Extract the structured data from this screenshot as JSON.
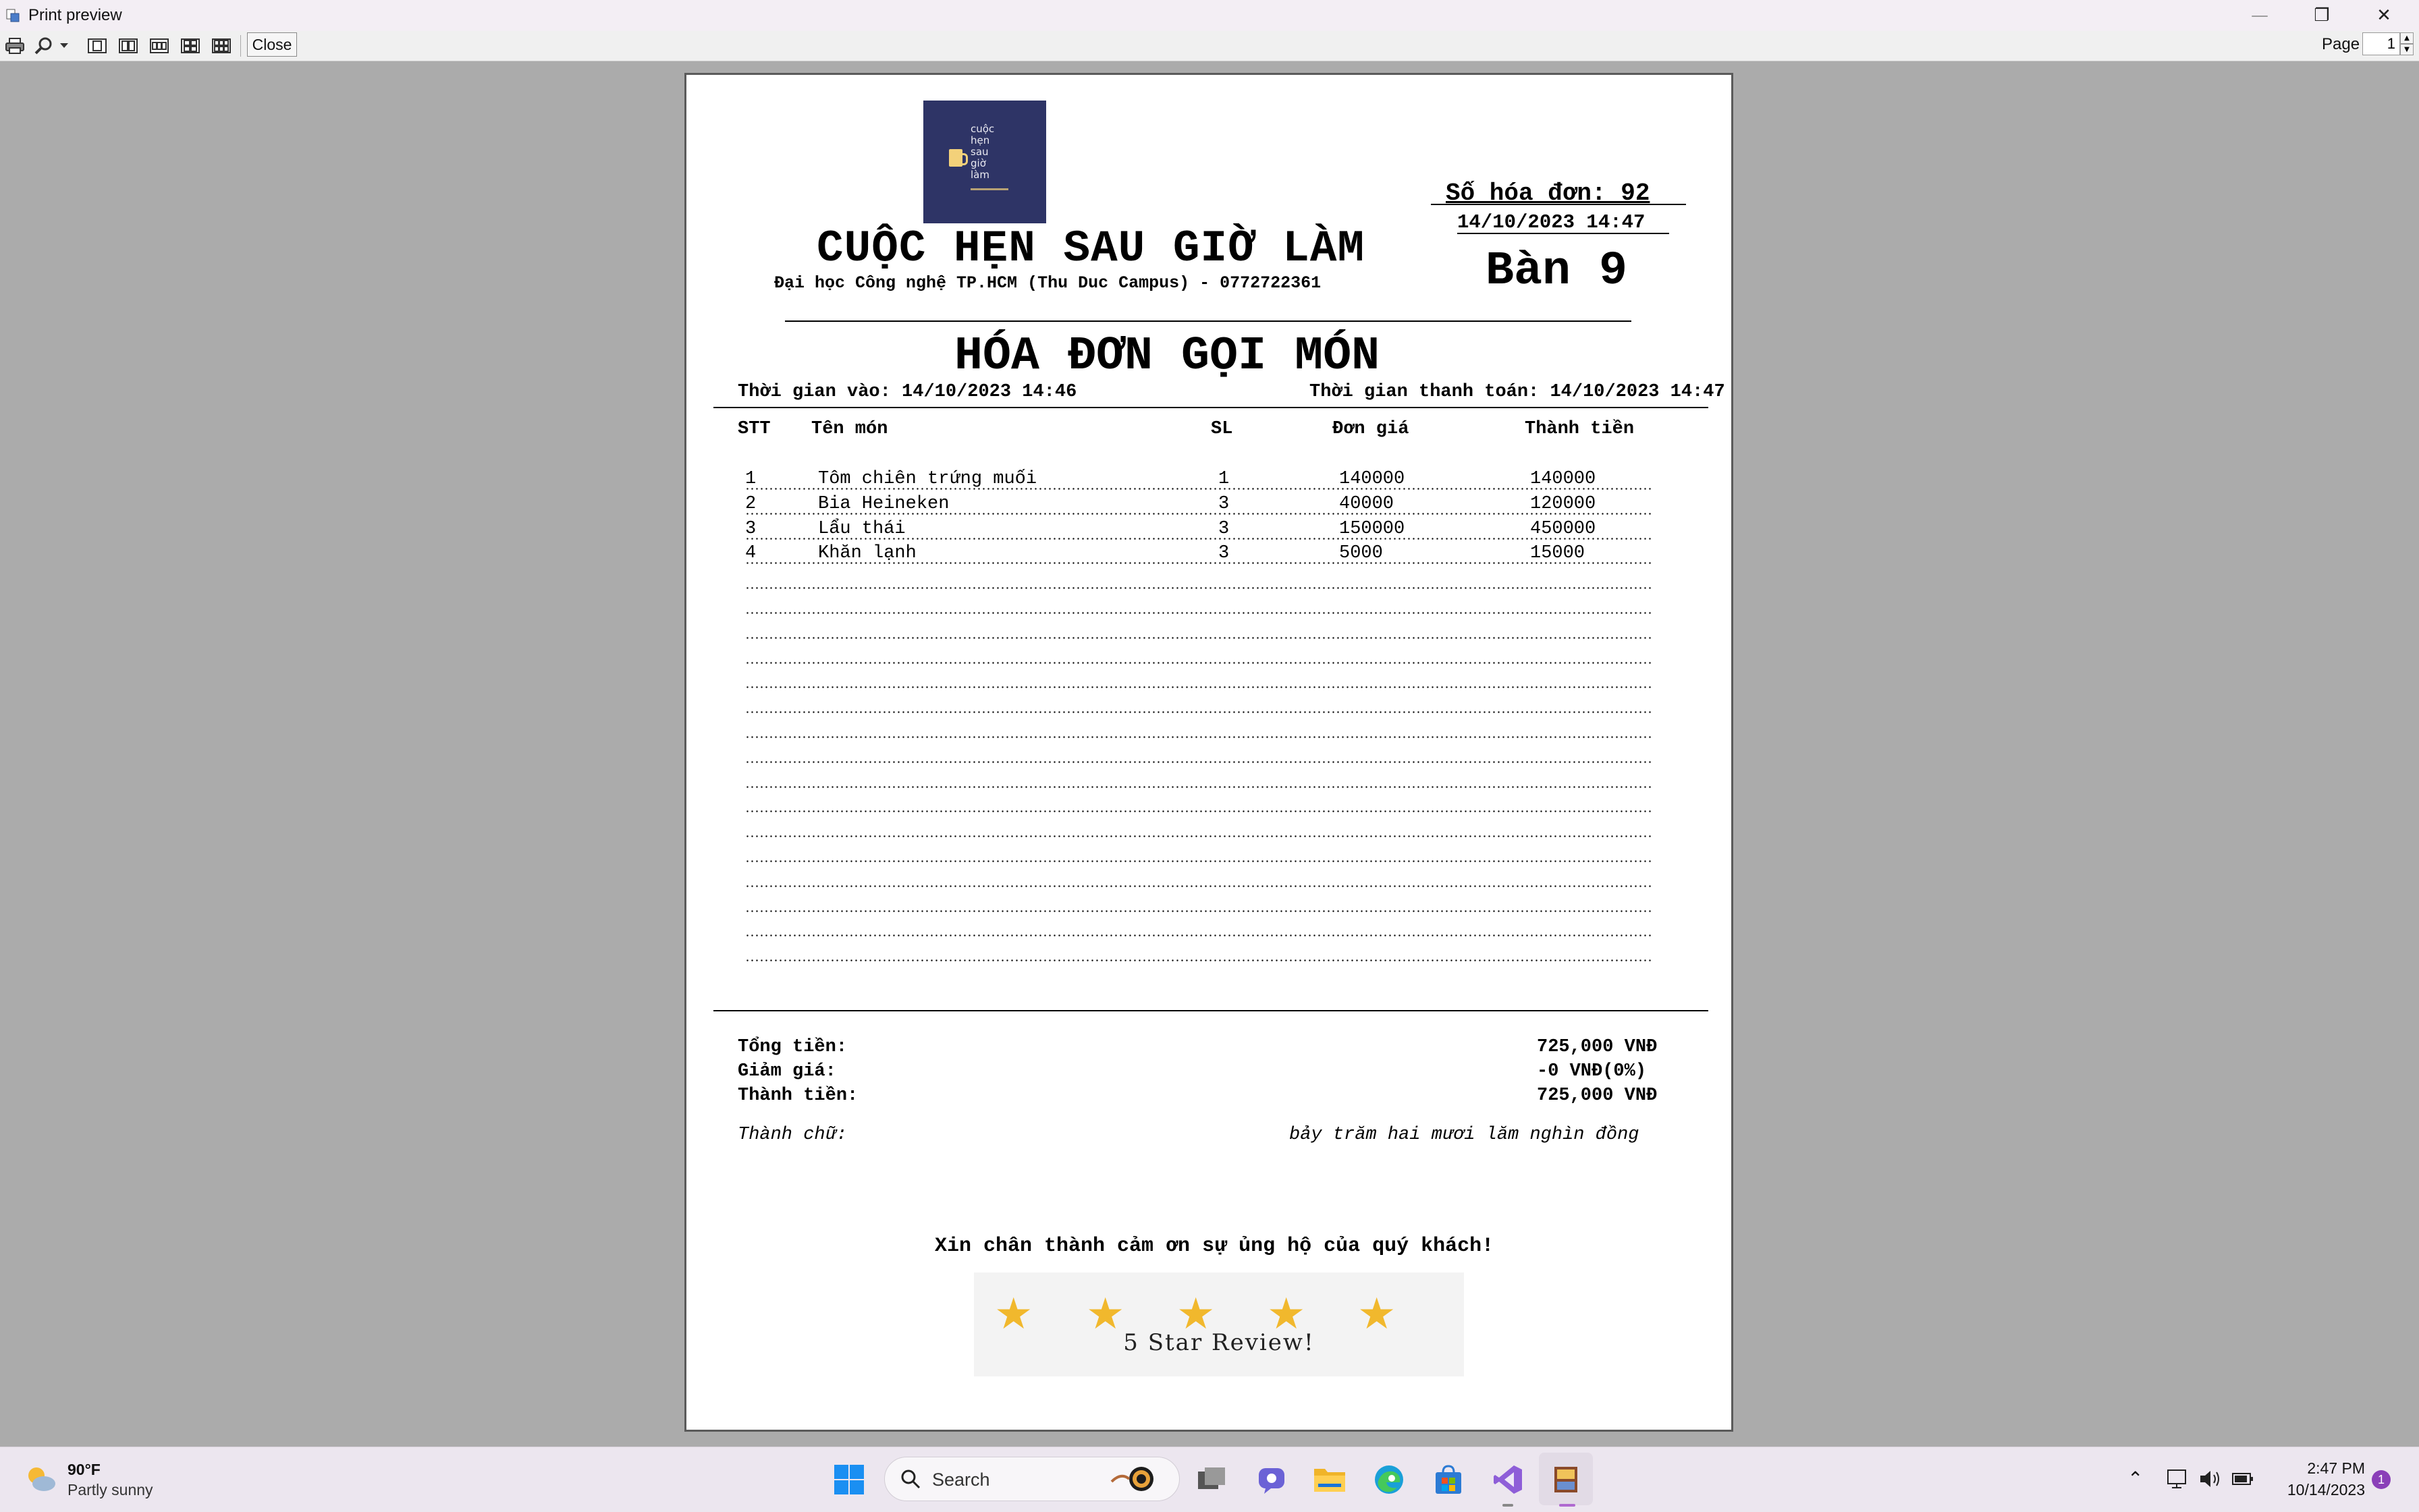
{
  "window": {
    "title": "Print preview",
    "minimize_glyph": "—",
    "restore_glyph": "❐",
    "close_glyph": "✕"
  },
  "toolbar": {
    "icons": [
      "print-icon",
      "zoom-icon",
      "dropdown-arrow-icon",
      "one-page-icon",
      "two-pages-icon",
      "three-pages-icon",
      "four-pages-icon",
      "six-pages-icon"
    ],
    "close_label": "Close",
    "page_label": "Page",
    "page_value": "1"
  },
  "receipt": {
    "logo_text": [
      "cuộc",
      "hẹn",
      "sau",
      "giờ",
      "làm"
    ],
    "invoice_number": "Số hóa đơn: 92",
    "invoice_datetime": "14/10/2023 14:47",
    "store_name": "CUỘC HẸN SAU GIỜ LÀM",
    "store_address": "Đại học Công nghệ TP.HCM (Thu Duc Campus) - 0772722361",
    "table_label": "Bàn 9",
    "doc_title": "HÓA ĐƠN GỌI MÓN",
    "time_in": "Thời gian vào: 14/10/2023 14:46",
    "time_paid": "Thời gian thanh toán: 14/10/2023 14:47",
    "columns": [
      "STT",
      "Tên món",
      "SL",
      "Đơn giá",
      "Thành tiền"
    ],
    "items": [
      {
        "stt": "1",
        "name": "Tôm chiên trứng muối",
        "qty": "1",
        "price": "140000",
        "total": "140000"
      },
      {
        "stt": "2",
        "name": "Bia Heineken",
        "qty": "3",
        "price": "40000",
        "total": "120000"
      },
      {
        "stt": "3",
        "name": "Lẩu thái",
        "qty": "3",
        "price": "150000",
        "total": "450000"
      },
      {
        "stt": "4",
        "name": "Khăn lạnh",
        "qty": "3",
        "price": "5000",
        "total": "15000"
      }
    ],
    "subtotal_label": "Tổng tiền:",
    "subtotal_value": "725,000 VNĐ",
    "discount_label": "Giảm giá:",
    "discount_value": "-0 VNĐ(0%)",
    "total_label": "Thành tiền:",
    "total_value": "725,000 VNĐ",
    "in_words_label": "Thành chữ:",
    "in_words_value": "bảy trăm hai mươi lăm nghìn đồng",
    "thanks": "Xin chân thành cảm ơn sự ủng hộ của quý khách!",
    "review_text": "5 Star Review!",
    "review_stars": 5
  },
  "taskbar": {
    "weather_temp": "90°F",
    "weather_desc": "Partly sunny",
    "search_placeholder": "Search",
    "apps": [
      "windows-start-icon",
      "search-icon",
      "task-view-icon",
      "teams-chat-icon",
      "file-explorer-icon",
      "edge-browser-icon",
      "microsoft-store-icon",
      "visual-studio-icon",
      "restaurant-app-icon"
    ],
    "clock_time": "2:47 PM",
    "clock_date": "10/14/2023",
    "notification_count": "1"
  },
  "colors": {
    "background": "#ababab",
    "logo_bg": "#2e3466",
    "star": "#f1b82d",
    "taskbar": "#ece6ef"
  }
}
